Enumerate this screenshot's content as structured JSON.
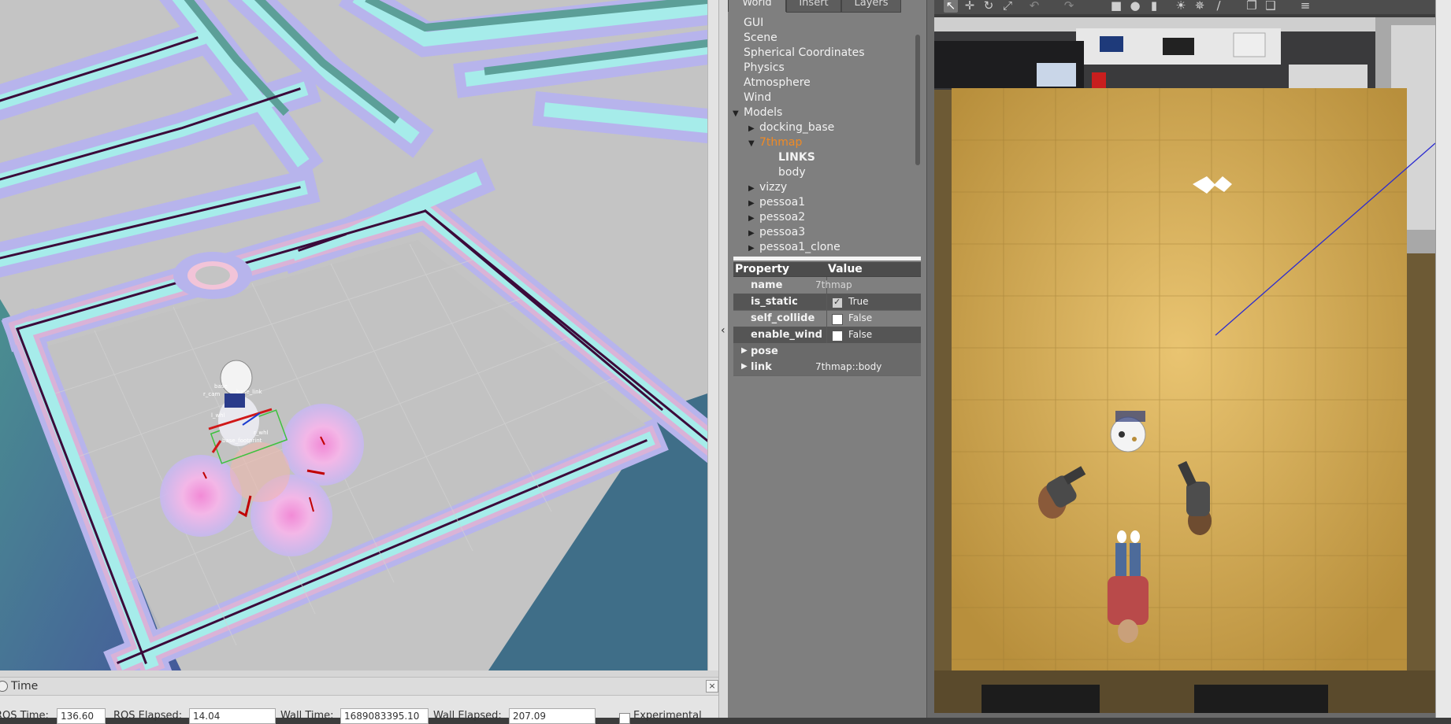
{
  "rviz": {
    "time_panel": {
      "title": "Time",
      "close": "×",
      "fields": [
        {
          "label": "ROS Time:",
          "value": "136.60"
        },
        {
          "label": "ROS Elapsed:",
          "value": "14.04"
        },
        {
          "label": "Wall Time:",
          "value": "1689083395.10"
        },
        {
          "label": "Wall Elapsed:",
          "value": "207.09"
        },
        {
          "label": "Experimental",
          "value": ""
        }
      ]
    },
    "splitter_arrow": "‹",
    "robot_labels": [
      "base",
      "r_cam",
      "base_link",
      "l_whl",
      "r_whl",
      "base_footprint"
    ]
  },
  "gazebo": {
    "tabs": [
      "World",
      "Insert",
      "Layers"
    ],
    "active_tab": "World",
    "tree": [
      {
        "label": "GUI",
        "indent": 0,
        "expand": "none"
      },
      {
        "label": "Scene",
        "indent": 0,
        "expand": "none"
      },
      {
        "label": "Spherical Coordinates",
        "indent": 0,
        "expand": "none"
      },
      {
        "label": "Physics",
        "indent": 0,
        "expand": "none"
      },
      {
        "label": "Atmosphere",
        "indent": 0,
        "expand": "none"
      },
      {
        "label": "Wind",
        "indent": 0,
        "expand": "none"
      },
      {
        "label": "Models",
        "indent": 0,
        "expand": "open"
      },
      {
        "label": "docking_base",
        "indent": 1,
        "expand": "closed"
      },
      {
        "label": "7thmap",
        "indent": 1,
        "expand": "open",
        "selected": true
      },
      {
        "label": "LINKS",
        "indent": 2,
        "expand": "none",
        "bold": true
      },
      {
        "label": "body",
        "indent": 2,
        "expand": "none"
      },
      {
        "label": "vizzy",
        "indent": 1,
        "expand": "closed"
      },
      {
        "label": "pessoa1",
        "indent": 1,
        "expand": "closed"
      },
      {
        "label": "pessoa2",
        "indent": 1,
        "expand": "closed"
      },
      {
        "label": "pessoa3",
        "indent": 1,
        "expand": "closed"
      },
      {
        "label": "pessoa1_clone",
        "indent": 1,
        "expand": "closed"
      }
    ],
    "properties": {
      "header": {
        "property": "Property",
        "value": "Value"
      },
      "rows": [
        {
          "name": "name",
          "value": "7thmap",
          "type": "text"
        },
        {
          "name": "is_static",
          "value": "True",
          "type": "check",
          "checked": true
        },
        {
          "name": "self_collide",
          "value": "False",
          "type": "check",
          "checked": false
        },
        {
          "name": "enable_wind",
          "value": "False",
          "type": "check",
          "checked": false
        },
        {
          "name": "pose",
          "value": "",
          "type": "group"
        },
        {
          "name": "link",
          "value": "7thmap::body",
          "type": "group"
        }
      ]
    },
    "toolbar_icons": [
      "select-arrow-icon",
      "translate-icon",
      "rotate-icon",
      "scale-icon",
      "undo-icon",
      "redo-icon",
      "box-icon",
      "sphere-icon",
      "cylinder-icon",
      "point-light-icon",
      "spot-light-icon",
      "directional-light-icon",
      "copy-icon",
      "paste-icon",
      "align-icon"
    ],
    "colors": {
      "selected": "#f08a24",
      "floor": "#c8a251",
      "panel": "#7f7f7f"
    }
  }
}
